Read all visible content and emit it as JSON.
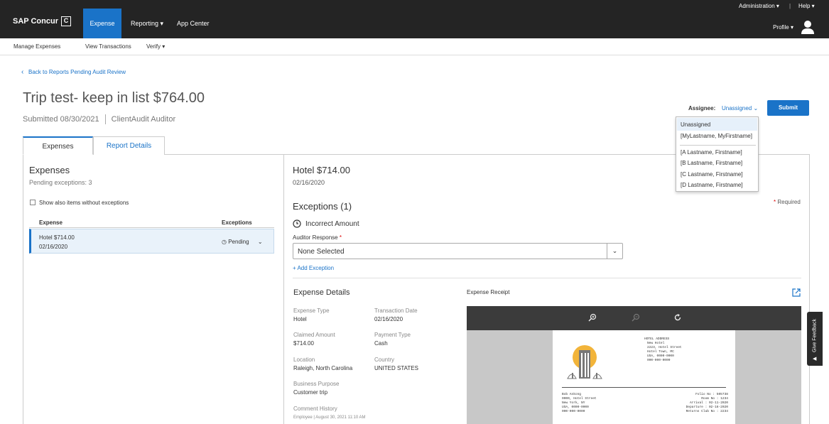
{
  "header": {
    "brand": "SAP Concur",
    "brand_glyph": "C",
    "nav": [
      "Expense",
      "Reporting ▾",
      "App Center"
    ],
    "administration": "Administration ▾",
    "help": "Help ▾",
    "profile": "Profile ▾"
  },
  "subnav": [
    "Manage Expenses",
    "View Transactions",
    "Verify ▾"
  ],
  "back_link": "Back to Reports Pending Audit Review",
  "report": {
    "title": "Trip test- keep in list $764.00",
    "submitted": "Submitted  08/30/2021",
    "auditor": "ClientAudit Auditor"
  },
  "assignee": {
    "label": "Assignee:",
    "value": "Unassigned",
    "options": [
      "Unassigned",
      "[MyLastname, MyFirstname]",
      "[A Lastname, Firstname]",
      "[B Lastname, Firstname]",
      "[C Lastname, Firstname]",
      "[D Lastname, Firstname]"
    ]
  },
  "submit_label": "Submit",
  "tabs": [
    "Expenses",
    "Report Details"
  ],
  "left": {
    "heading": "Expenses",
    "pending": "Pending exceptions: 3",
    "show_all": "Show also items without exceptions",
    "col_expense": "Expense",
    "col_exceptions": "Exceptions",
    "rows": [
      {
        "title": "Hotel  $714.00",
        "date": "02/16/2020",
        "status": "Pending"
      }
    ]
  },
  "detail": {
    "heading": "Hotel  $714.00",
    "date": "02/16/2020",
    "exceptions_heading": "Exceptions (1)",
    "required": "Required",
    "exception_name": "Incorrect Amount",
    "auditor_response_label": "Auditor Response",
    "auditor_response_value": "None Selected",
    "add_exception": "+ Add Exception",
    "expense_details_heading": "Expense Details",
    "expense_receipt_heading": "Expense Receipt",
    "fields": {
      "expense_type_l": "Expense Type",
      "expense_type_v": "Hotel",
      "transaction_date_l": "Transaction Date",
      "transaction_date_v": "02/16/2020",
      "claimed_amount_l": "Claimed Amount",
      "claimed_amount_v": "$714.00",
      "payment_type_l": "Payment Type",
      "payment_type_v": "Cash",
      "location_l": "Location",
      "location_v": "Raleigh, North Carolina",
      "country_l": "Country",
      "country_v": "UNITED STATES",
      "business_purpose_l": "Business Purpose",
      "business_purpose_v": "Customer trip",
      "comment_history_l": "Comment History",
      "comment_meta": "Employee | August 30, 2021 11:10 AM"
    }
  },
  "receipt": {
    "hotel_lines": [
      "HOTEL ADDRESS",
      "New Hotel",
      "2223, Hotel Street",
      "Hotel Town, MC",
      "USA, 0000-0000",
      "000-000-0000"
    ],
    "guest_lines": [
      "Bob Ankong",
      "0000, Hotel Street",
      "New York, NY",
      "USA, 0000-0000",
      "000-000-0000"
    ],
    "folio_lines": [
      "Folio No : 505738",
      "Room No : 1234",
      "Arrival : 02-11-2020",
      "Departure : 02-16-2020",
      "Returns Club No : 2234"
    ]
  },
  "feedback": "Give Feedback",
  "colors": {
    "accent": "#1a73c8",
    "topbar": "#242424"
  }
}
